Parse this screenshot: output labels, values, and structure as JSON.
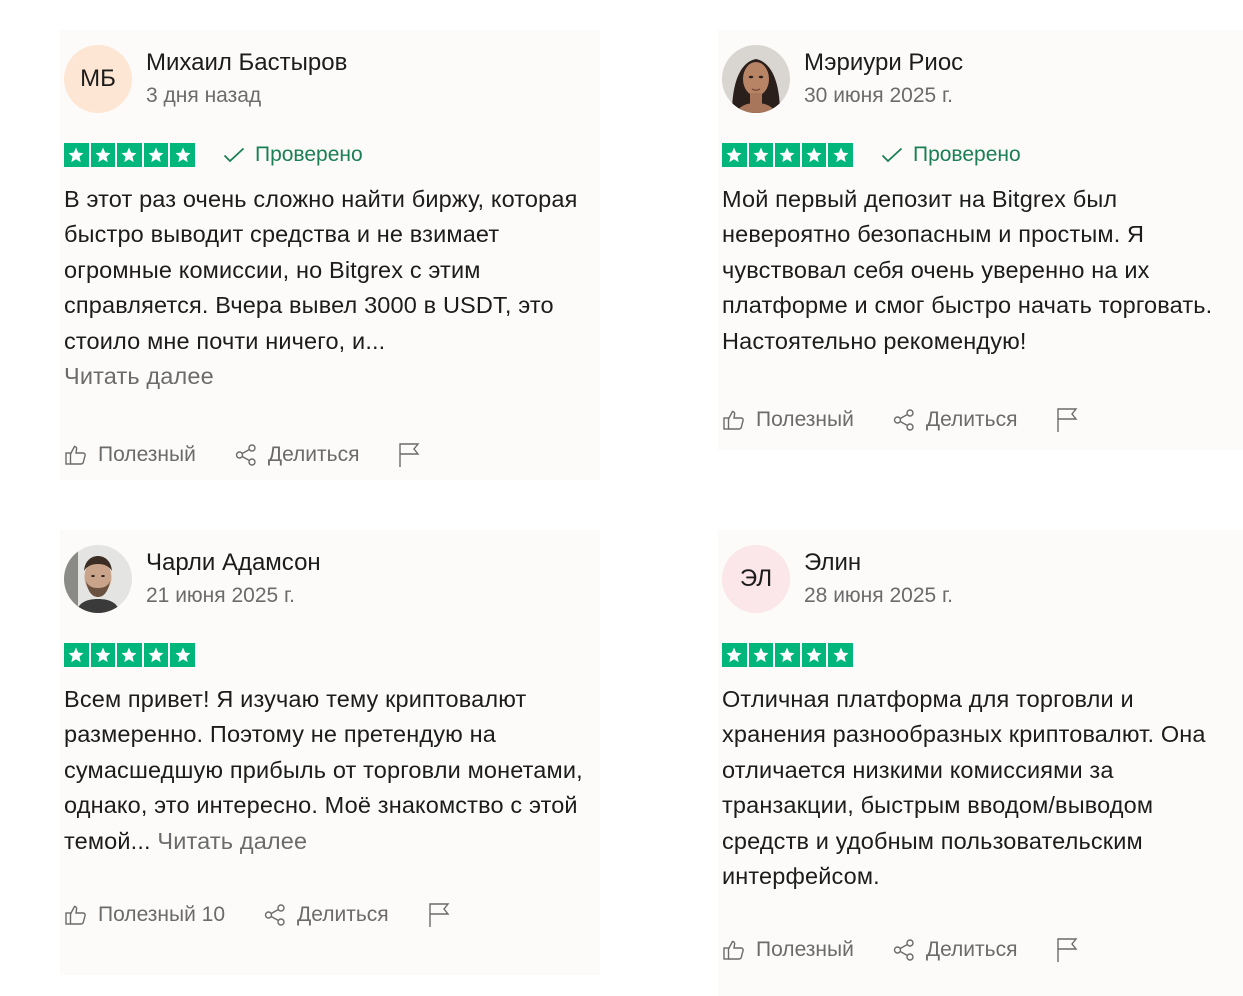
{
  "colors": {
    "star_green": "#00b67a",
    "verified_green": "#1a7f54",
    "muted_text": "#6b6b6b"
  },
  "reviews": [
    {
      "author": "Михаил Бастыров",
      "initials": "МБ",
      "date": "3 дня назад",
      "rating": 5,
      "verified": "Проверено",
      "text": "В этот раз очень сложно найти биржу, которая быстро выводит средства и не взимает огромные комиссии, но Bitgrex с этим справляется. Вчера вывел 3000 в USDT, это стоило мне почти ничего, и...",
      "read_more": "Читать далее",
      "helpful": "Полезный",
      "share": "Делиться"
    },
    {
      "author": "Мэриури Риос",
      "avatar": "woman-portrait-photo",
      "date": "30 июня 2025 г.",
      "rating": 5,
      "verified": "Проверено",
      "text": "Мой первый депозит на Bitgrex был невероятно безопасным и простым. Я чувствовал себя очень уверенно на их платформе и смог быстро начать торговать. Настоятельно рекомендую!",
      "helpful": "Полезный",
      "share": "Делиться"
    },
    {
      "author": "Чарли Адамсон",
      "avatar": "man-portrait-photo",
      "date": "21 июня 2025 г.",
      "rating": 5,
      "text": "Всем привет! Я изучаю тему криптовалют размеренно. Поэтому не претендую на сумасшедшую прибыль от торговли монетами, однако, это интересно. Моё знакомство с этой темой...",
      "read_more": "Читать далее",
      "helpful": "Полезный 10",
      "share": "Делиться"
    },
    {
      "author": "Элин",
      "initials": "ЭЛ",
      "date": "28 июня 2025 г.",
      "rating": 5,
      "text": "Отличная платформа для торговли и хранения разнообразных криптовалют. Она отличается низкими комиссиями за транзакции, быстрым вводом/выводом средств и удобным пользовательским интерфейсом.",
      "helpful": "Полезный",
      "share": "Делиться"
    }
  ]
}
